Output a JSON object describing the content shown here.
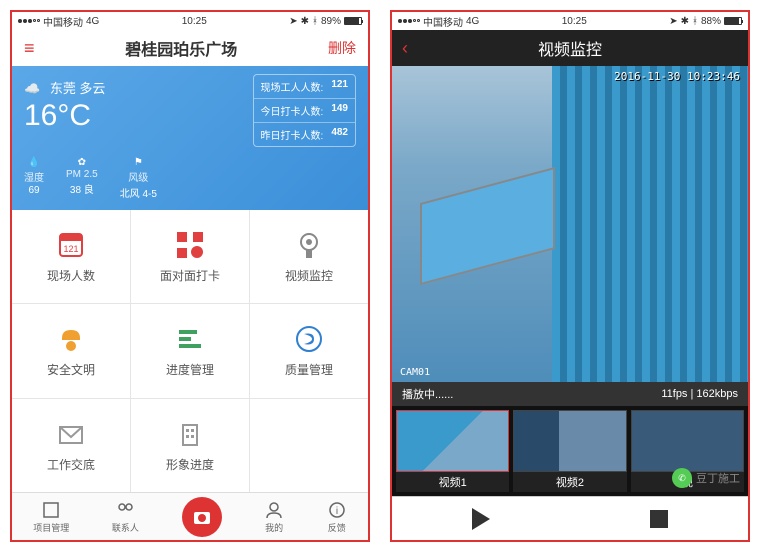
{
  "screen1": {
    "status": {
      "carrier": "中国移动",
      "network": "4G",
      "time": "10:25",
      "battery": "89%"
    },
    "nav": {
      "title": "碧桂园珀乐广场",
      "delete": "删除"
    },
    "weather": {
      "location": "东莞 多云",
      "temp": "16°C",
      "stats": [
        {
          "label": "现场工人人数:",
          "value": "121"
        },
        {
          "label": "今日打卡人数:",
          "value": "149"
        },
        {
          "label": "昨日打卡人数:",
          "value": "482"
        }
      ],
      "metrics": [
        {
          "icon": "💧",
          "label": "湿度",
          "value": "69"
        },
        {
          "icon": "✿",
          "label": "PM 2.5",
          "value": "38 良"
        },
        {
          "icon": "⚑",
          "label": "风级",
          "value": "北风 4-5"
        }
      ]
    },
    "grid": [
      {
        "label": "现场人数",
        "icon": "calendar",
        "color": "#e04040"
      },
      {
        "label": "面对面打卡",
        "icon": "qr",
        "color": "#e04040"
      },
      {
        "label": "视频监控",
        "icon": "camera",
        "color": "#888"
      },
      {
        "label": "安全文明",
        "icon": "helmet",
        "color": "#f0a030"
      },
      {
        "label": "进度管理",
        "icon": "chart",
        "color": "#40a060"
      },
      {
        "label": "质量管理",
        "icon": "badge",
        "color": "#3080d0"
      },
      {
        "label": "工作交底",
        "icon": "mail",
        "color": "#999"
      },
      {
        "label": "形象进度",
        "icon": "building",
        "color": "#999"
      }
    ],
    "tabs": [
      {
        "label": "项目管理"
      },
      {
        "label": "联系人"
      },
      {
        "label": ""
      },
      {
        "label": "我的"
      },
      {
        "label": "反馈"
      }
    ]
  },
  "screen2": {
    "status": {
      "carrier": "中国移动",
      "network": "4G",
      "time": "10:25",
      "battery": "88%"
    },
    "nav": {
      "title": "视频监控"
    },
    "video": {
      "timestamp": "2016-11-30 10:23:46",
      "cam": "CAM01"
    },
    "playbar": {
      "status": "播放中......",
      "info": "11fps | 162kbps"
    },
    "thumbs": [
      {
        "label": "视频1"
      },
      {
        "label": "视频2"
      },
      {
        "label": "视"
      }
    ],
    "watermark": "豆丁施工"
  }
}
